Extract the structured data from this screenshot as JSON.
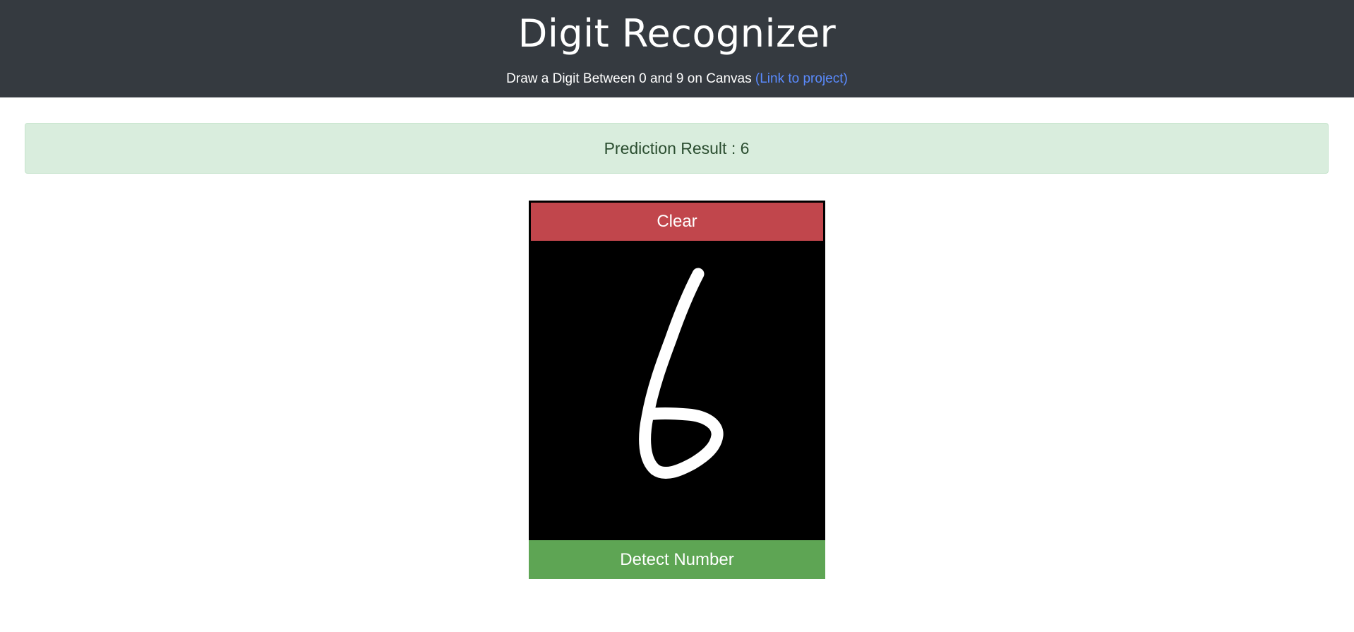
{
  "header": {
    "title": "Digit Recognizer",
    "subtitle": "Draw a Digit Between 0 and 9 on Canvas",
    "link_text": "(Link to project)",
    "background_color": "#353a40",
    "link_color": "#5a8bff"
  },
  "prediction": {
    "text": "Prediction Result : 6",
    "background_color": "#d9eddd"
  },
  "drawing": {
    "clear_label": "Clear",
    "detect_label": "Detect Number",
    "clear_color": "#c1464c",
    "detect_color": "#5ea554",
    "canvas_color": "#000000",
    "stroke_color": "#ffffff",
    "drawn_digit": "6"
  }
}
